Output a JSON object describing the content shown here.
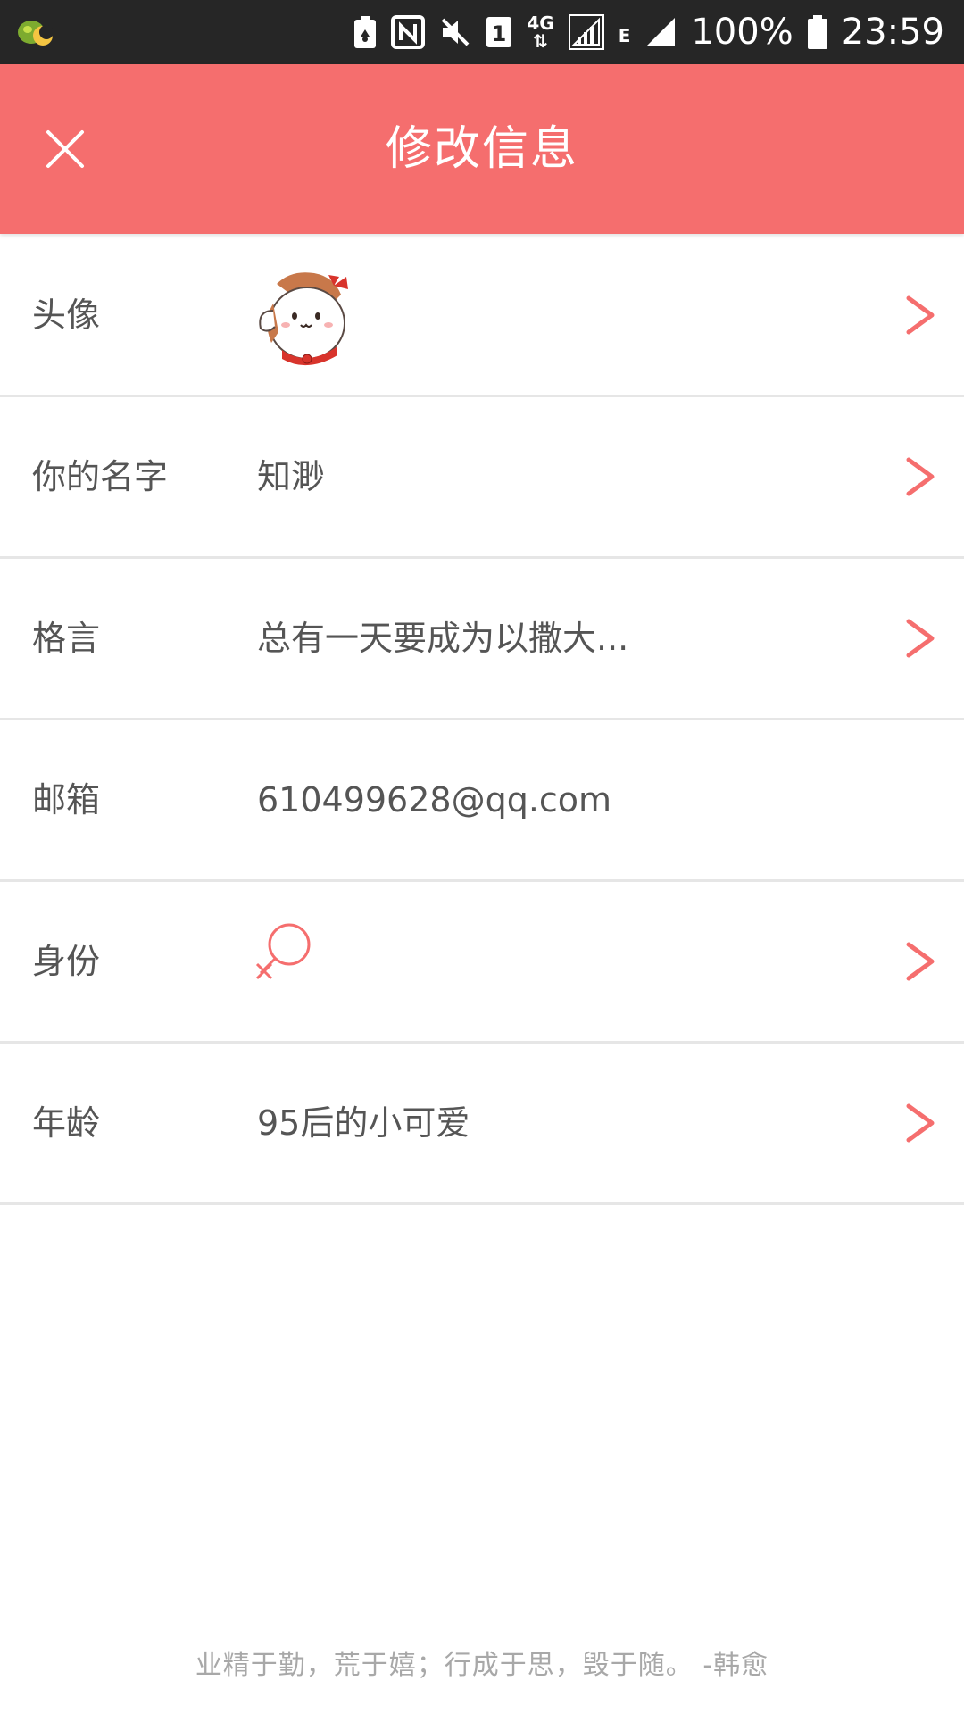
{
  "status_bar": {
    "battery_percent": "100%",
    "time": "23:59",
    "network": "4G",
    "data_type": "E",
    "sim_slot": "1",
    "icons": [
      "app-notification-icon",
      "battery-saver-icon",
      "nfc-icon",
      "mute-icon",
      "sim-1-icon",
      "4g-data-icon",
      "signal-icon",
      "e-data-icon",
      "signal-icon",
      "battery-icon"
    ]
  },
  "header": {
    "title": "修改信息",
    "close_icon": "close-icon",
    "background_color": "#f56e6e"
  },
  "rows": [
    {
      "label": "头像",
      "value": "",
      "type": "avatar",
      "has_arrow": true
    },
    {
      "label": "你的名字",
      "value": "知渺",
      "type": "text",
      "has_arrow": true
    },
    {
      "label": "格言",
      "value": "总有一天要成为以撒大...",
      "type": "text",
      "has_arrow": true
    },
    {
      "label": "邮箱",
      "value": "610499628@qq.com",
      "type": "text",
      "has_arrow": false
    },
    {
      "label": "身份",
      "value": "",
      "type": "gender-female",
      "has_arrow": true
    },
    {
      "label": "年龄",
      "value": "95后的小可爱",
      "type": "text",
      "has_arrow": true
    }
  ],
  "footer": {
    "quote": "业精于勤，荒于嬉；行成于思，毁于随。 -韩愈"
  },
  "colors": {
    "accent": "#f56e6e",
    "label_text": "#555555",
    "divider": "#e6e6e6",
    "footer_text": "#a8a8a8"
  }
}
